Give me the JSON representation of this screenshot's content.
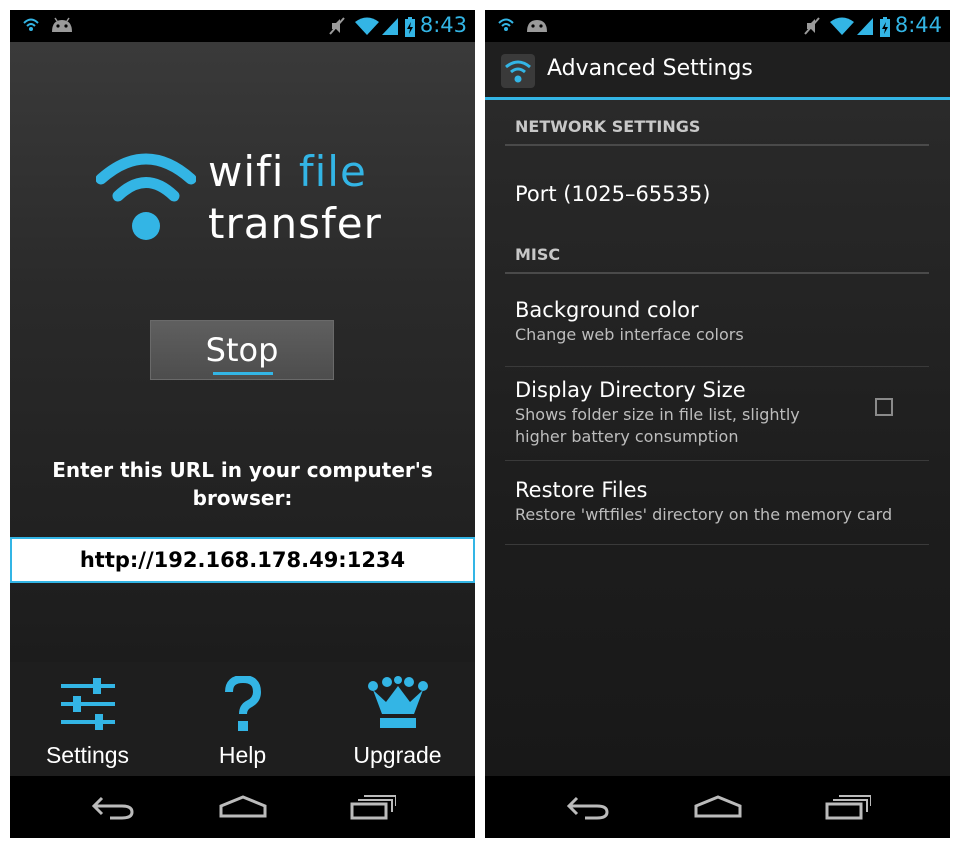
{
  "colors": {
    "accent": "#33b5e5",
    "background": "#000000",
    "button": "#555555"
  },
  "left": {
    "status": {
      "time": "8:43",
      "icons": [
        "wifi-icon",
        "android-icon",
        "mute-icon",
        "wifi-signal-icon",
        "cell-signal-icon",
        "battery-icon"
      ]
    },
    "logo": {
      "word1": "wifi",
      "word2": "file",
      "word3": "transfer"
    },
    "stop_label": "Stop",
    "instruction": "Enter this URL in your computer's browser:",
    "url": "http://192.168.178.49:1234",
    "actions": [
      {
        "label": "Settings",
        "icon": "settings-sliders-icon"
      },
      {
        "label": "Help",
        "icon": "question-mark-icon"
      },
      {
        "label": "Upgrade",
        "icon": "crown-icon"
      }
    ],
    "nav": [
      "back-icon",
      "home-icon",
      "recent-apps-icon"
    ]
  },
  "right": {
    "status": {
      "time": "8:44"
    },
    "title": "Advanced Settings",
    "sections": [
      {
        "header": "NETWORK SETTINGS"
      },
      {
        "header": "MISC"
      }
    ],
    "prefs": {
      "port": {
        "title": "Port (1025–65535)"
      },
      "background_color": {
        "title": "Background color",
        "summary": "Change web interface colors"
      },
      "directory_size": {
        "title": "Display Directory Size",
        "summary_line1": "Shows folder size in file list, slightly",
        "summary_line2": "higher battery consumption",
        "checked": false
      },
      "restore": {
        "title": "Restore Files",
        "summary": "Restore 'wftfiles' directory on the memory card"
      }
    }
  }
}
